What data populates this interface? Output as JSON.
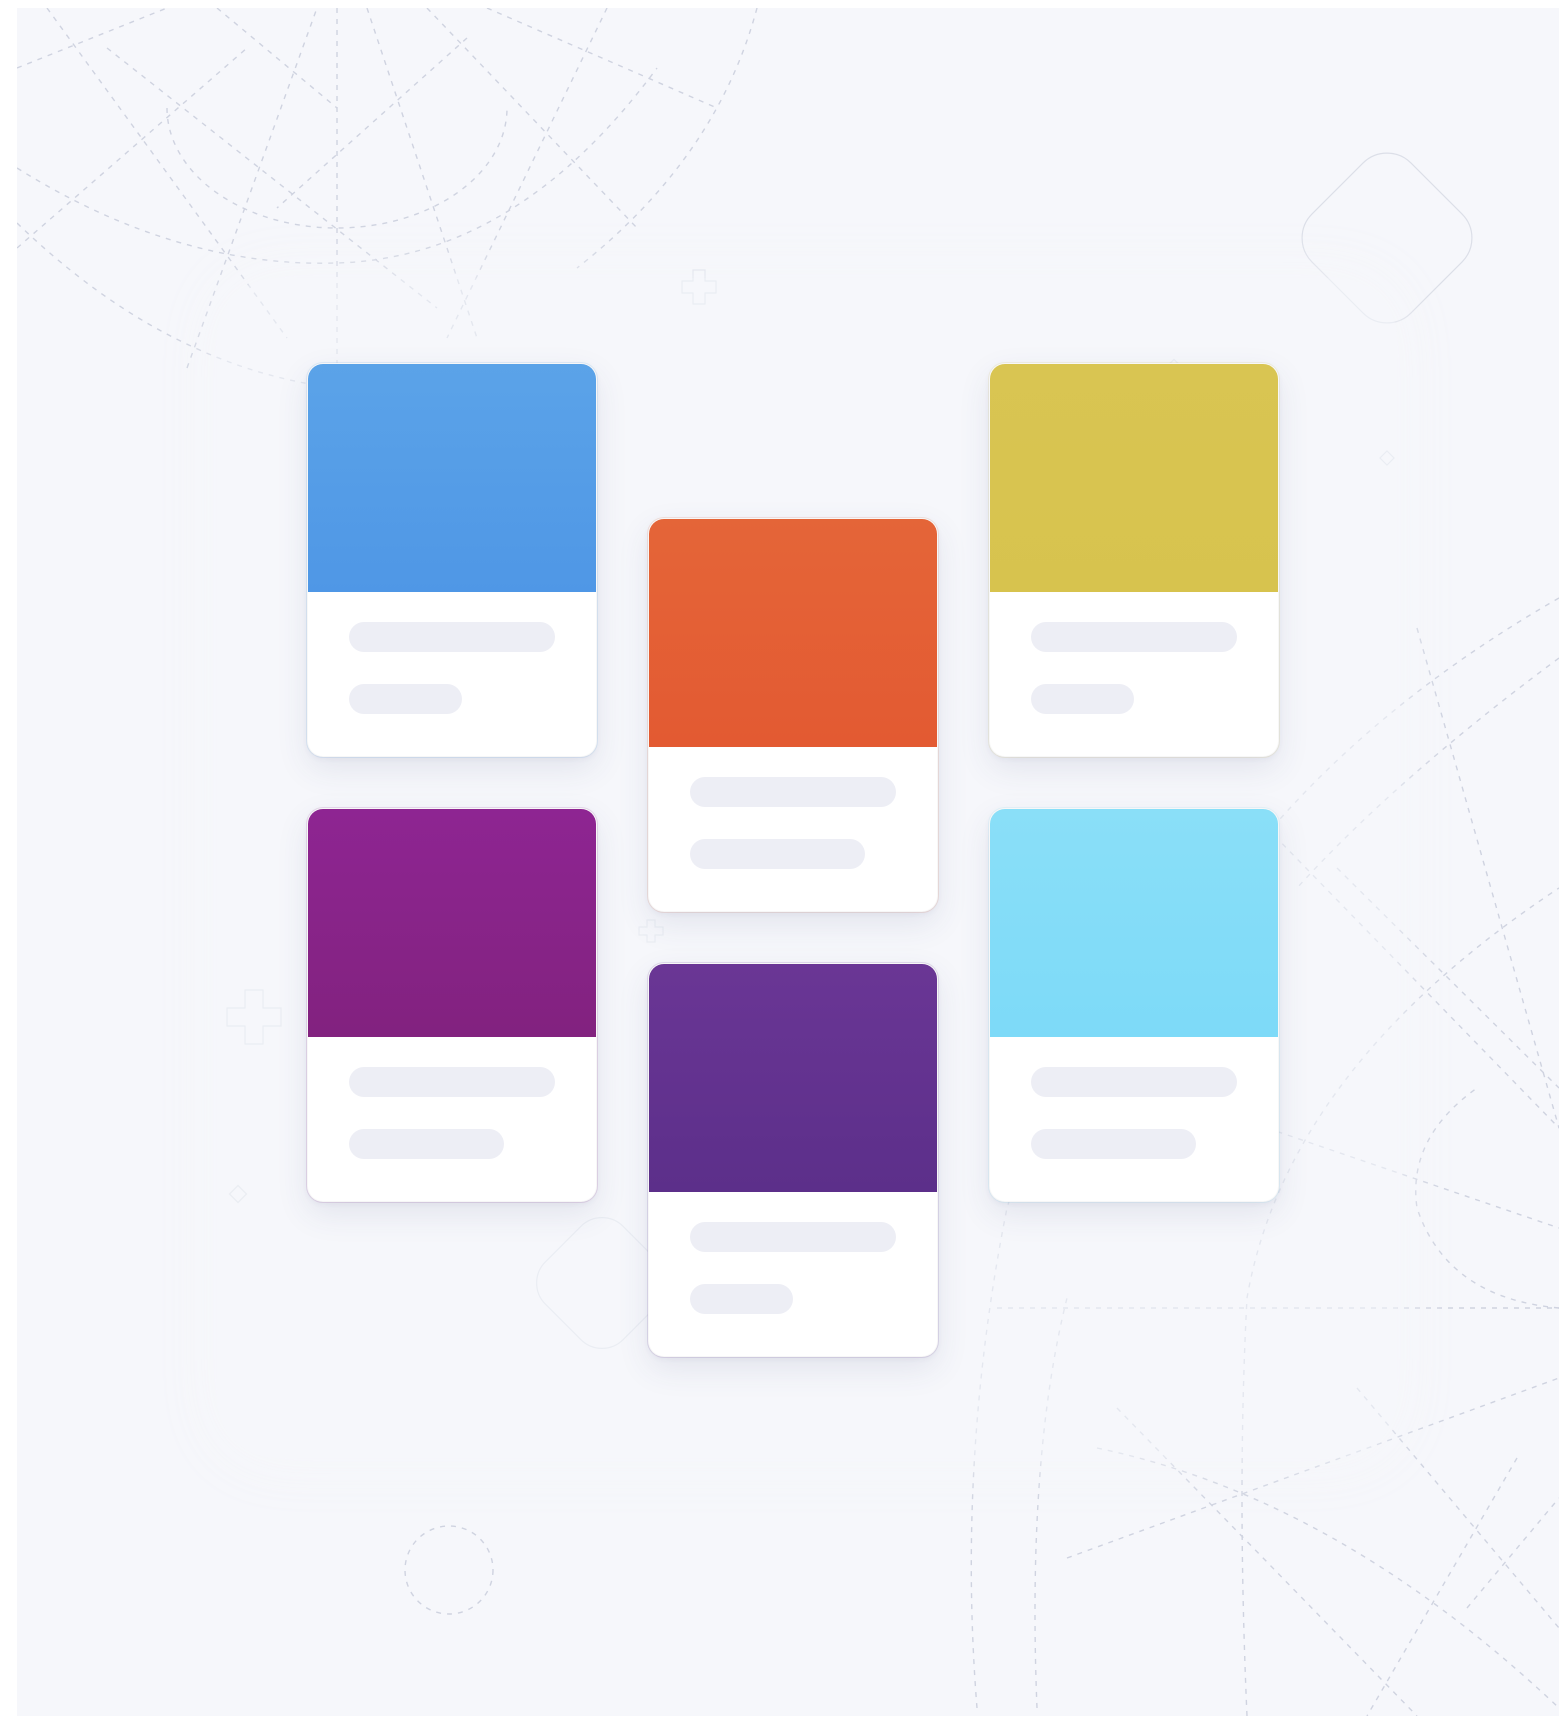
{
  "palette": {
    "background": "#f6f7fb",
    "placeholder_line": "#edeef5",
    "decoration_stroke": "#cfd3e0"
  },
  "cards": [
    {
      "id": "blue",
      "top": "#5ba3e8",
      "bottom": "#4f97e6",
      "line2_fraction": 0.55
    },
    {
      "id": "orange",
      "top": "#e46538",
      "bottom": "#e35a32",
      "line2_fraction": 0.85
    },
    {
      "id": "yellow",
      "top": "#d9c552",
      "bottom": "#d7c34e",
      "line2_fraction": 0.5
    },
    {
      "id": "magenta",
      "top": "#8e2592",
      "bottom": "#82227f",
      "line2_fraction": 0.75
    },
    {
      "id": "purple",
      "top": "#6a3695",
      "bottom": "#5c2f8a",
      "line2_fraction": 0.5
    },
    {
      "id": "cyan",
      "top": "#8adff8",
      "bottom": "#7ddaf8",
      "line2_fraction": 0.8
    }
  ]
}
